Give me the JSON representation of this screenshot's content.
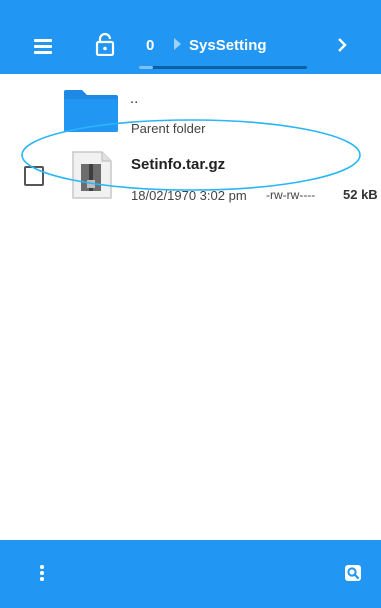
{
  "header": {
    "path_count": "0",
    "current_folder": "SysSetting",
    "icons": [
      "menu-icon",
      "lock-icon",
      "chevron-right-icon"
    ]
  },
  "list": {
    "parent": {
      "name": "..",
      "label": "Parent folder",
      "icon": "folder-icon"
    },
    "files": [
      {
        "name": "Setinfo.tar.gz",
        "date": "18/02/1970 3:02 pm",
        "permissions": "-rw-rw----",
        "size": "52 kB",
        "icon": "archive-icon",
        "checked": false
      }
    ]
  },
  "footer": {
    "icons": [
      "more-vert-icon",
      "search-icon"
    ]
  },
  "colors": {
    "primary": "#2196f3",
    "folder": "#1e88e5",
    "annotation": "#29b6f6"
  }
}
